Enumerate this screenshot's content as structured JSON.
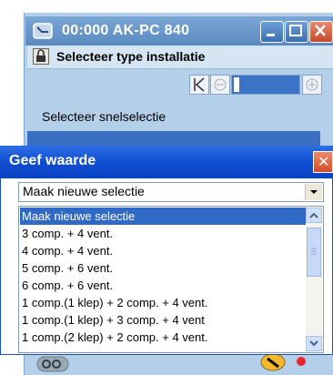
{
  "background_window": {
    "title": "00:000 AK-PC 840",
    "header_title": "Selecteer type installatie",
    "label": "Selecteer snelselectie",
    "colors": {
      "window": "#b4cfe9",
      "selection": "#3a6fc1"
    }
  },
  "dialog": {
    "title": "Geef waarde",
    "selected_value": "Maak nieuwe selectie",
    "items": [
      "Maak nieuwe selectie",
      "3 comp. + 4 vent.",
      "4 comp. + 4 vent.",
      "5 comp. + 6 vent.",
      "6 comp. + 6 vent.",
      "1 comp.(1 klep) + 2 comp. + 4 vent.",
      "1 comp.(1 klep) + 3 comp. + 4 vent",
      "1 comp.(2 klep) + 2 comp. + 4 vent."
    ],
    "selected_index": 0,
    "colors": {
      "titlebar": "#0f4cd0",
      "highlight": "#316ac5"
    }
  },
  "icons": {
    "app": "device-icon",
    "lock": "lock-icon",
    "key": "key-icon",
    "wrench": "wrench-icon",
    "close": "close-icon",
    "minimize": "minimize-icon",
    "maximize": "maximize-icon"
  }
}
